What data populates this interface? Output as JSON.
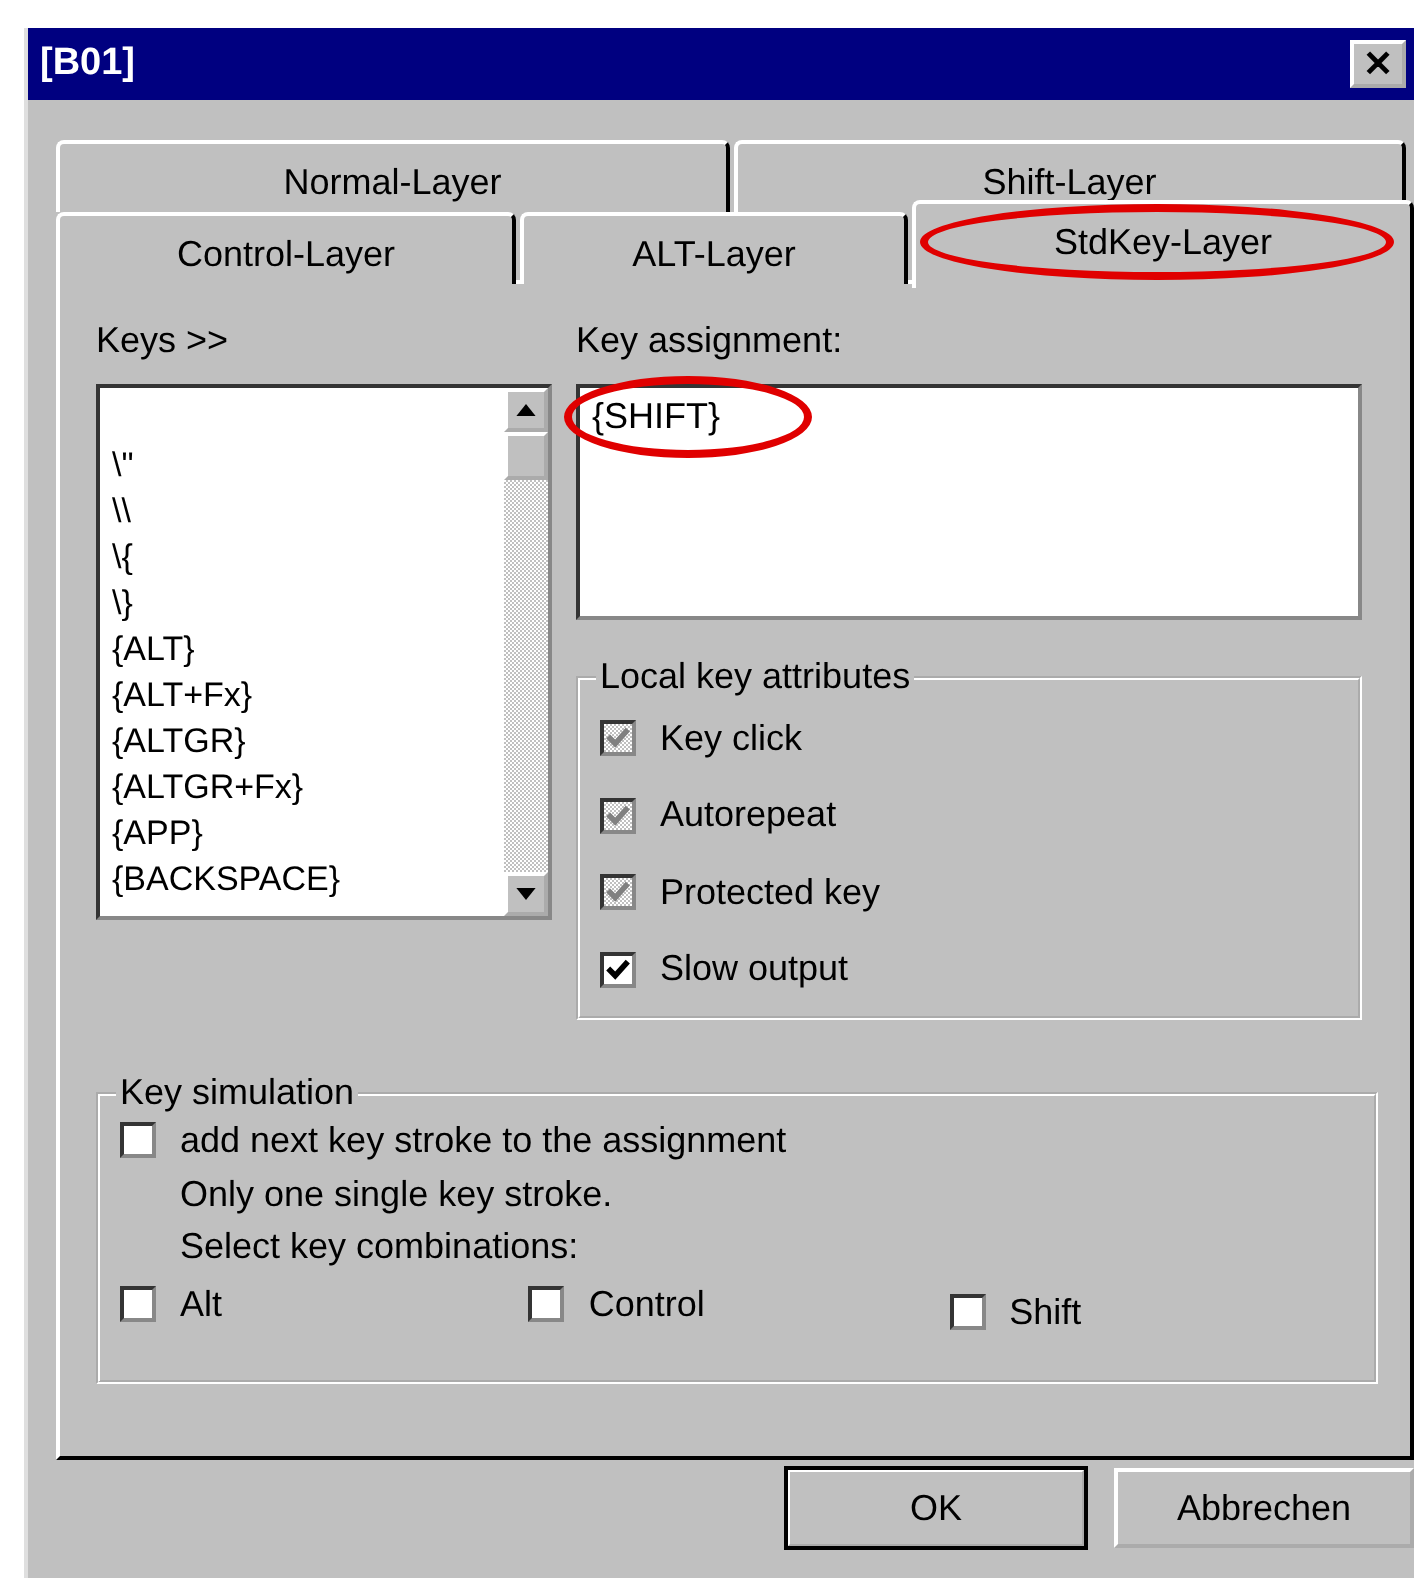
{
  "window": {
    "title": "[B01]",
    "close": "✕"
  },
  "tab_rows": [
    [
      {
        "label": "Normal-Layer",
        "selected": false,
        "circled": false
      },
      {
        "label": "Shift-Layer",
        "selected": false,
        "circled": false
      }
    ],
    [
      {
        "label": "Control-Layer",
        "selected": false,
        "circled": false
      },
      {
        "label": "ALT-Layer",
        "selected": false,
        "circled": false
      },
      {
        "label": "StdKey-Layer",
        "selected": true,
        "circled": true
      }
    ]
  ],
  "keys": {
    "label": "Keys >>",
    "items": [
      "\\\"",
      "\\\\",
      "\\{",
      "\\}",
      "{ALT}",
      "{ALT+Fx}",
      "{ALTGR}",
      "{ALTGR+Fx}",
      "{APP}",
      "{BACKSPACE}"
    ]
  },
  "assignment": {
    "label": "Key assignment:",
    "value": "{SHIFT}",
    "circled": true
  },
  "local_attributes": {
    "title": "Local key attributes",
    "options": [
      {
        "label": "Key click",
        "checked": true,
        "disabled": true
      },
      {
        "label": "Autorepeat",
        "checked": true,
        "disabled": true
      },
      {
        "label": "Protected key",
        "checked": true,
        "disabled": true
      },
      {
        "label": "Slow output",
        "checked": true,
        "disabled": false
      }
    ]
  },
  "key_simulation": {
    "title": "Key simulation",
    "add_stroke": {
      "label": "add next key stroke to the assignment",
      "checked": false
    },
    "notes": [
      "Only one single key stroke.",
      "Select key combinations:"
    ],
    "modifiers": [
      {
        "label": "Alt",
        "checked": false
      },
      {
        "label": "Control",
        "checked": false
      },
      {
        "label": "Shift",
        "checked": false
      }
    ]
  },
  "buttons": [
    "OK",
    "Abbrechen"
  ]
}
